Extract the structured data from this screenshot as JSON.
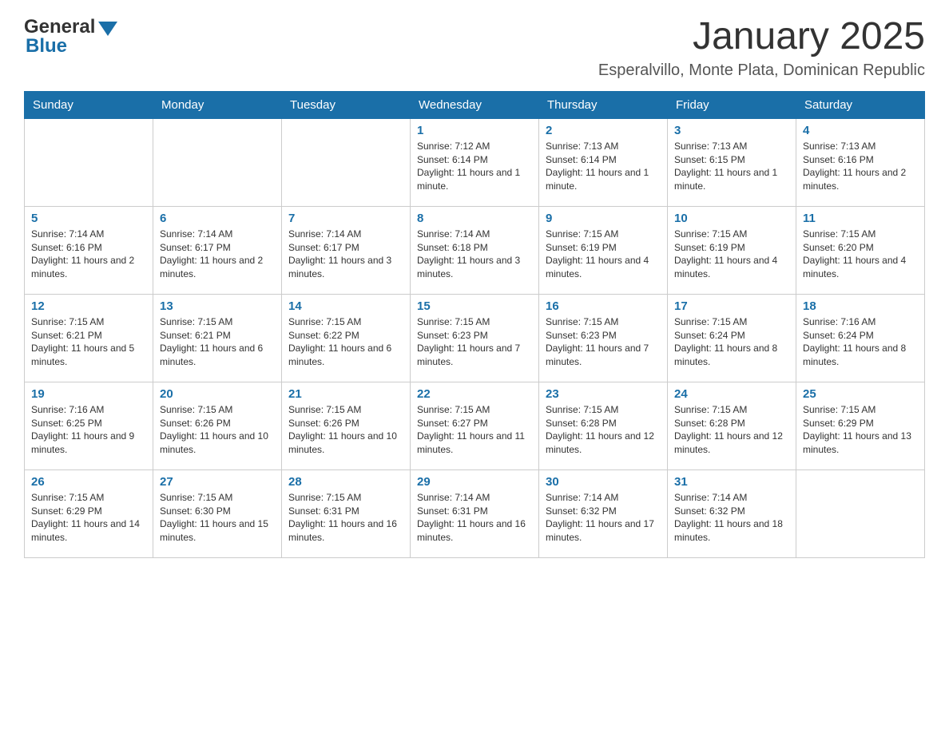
{
  "header": {
    "logo_general": "General",
    "logo_blue": "Blue",
    "title": "January 2025",
    "subtitle": "Esperalvillo, Monte Plata, Dominican Republic"
  },
  "weekdays": [
    "Sunday",
    "Monday",
    "Tuesday",
    "Wednesday",
    "Thursday",
    "Friday",
    "Saturday"
  ],
  "weeks": [
    [
      {
        "day": "",
        "info": ""
      },
      {
        "day": "",
        "info": ""
      },
      {
        "day": "",
        "info": ""
      },
      {
        "day": "1",
        "info": "Sunrise: 7:12 AM\nSunset: 6:14 PM\nDaylight: 11 hours and 1 minute."
      },
      {
        "day": "2",
        "info": "Sunrise: 7:13 AM\nSunset: 6:14 PM\nDaylight: 11 hours and 1 minute."
      },
      {
        "day": "3",
        "info": "Sunrise: 7:13 AM\nSunset: 6:15 PM\nDaylight: 11 hours and 1 minute."
      },
      {
        "day": "4",
        "info": "Sunrise: 7:13 AM\nSunset: 6:16 PM\nDaylight: 11 hours and 2 minutes."
      }
    ],
    [
      {
        "day": "5",
        "info": "Sunrise: 7:14 AM\nSunset: 6:16 PM\nDaylight: 11 hours and 2 minutes."
      },
      {
        "day": "6",
        "info": "Sunrise: 7:14 AM\nSunset: 6:17 PM\nDaylight: 11 hours and 2 minutes."
      },
      {
        "day": "7",
        "info": "Sunrise: 7:14 AM\nSunset: 6:17 PM\nDaylight: 11 hours and 3 minutes."
      },
      {
        "day": "8",
        "info": "Sunrise: 7:14 AM\nSunset: 6:18 PM\nDaylight: 11 hours and 3 minutes."
      },
      {
        "day": "9",
        "info": "Sunrise: 7:15 AM\nSunset: 6:19 PM\nDaylight: 11 hours and 4 minutes."
      },
      {
        "day": "10",
        "info": "Sunrise: 7:15 AM\nSunset: 6:19 PM\nDaylight: 11 hours and 4 minutes."
      },
      {
        "day": "11",
        "info": "Sunrise: 7:15 AM\nSunset: 6:20 PM\nDaylight: 11 hours and 4 minutes."
      }
    ],
    [
      {
        "day": "12",
        "info": "Sunrise: 7:15 AM\nSunset: 6:21 PM\nDaylight: 11 hours and 5 minutes."
      },
      {
        "day": "13",
        "info": "Sunrise: 7:15 AM\nSunset: 6:21 PM\nDaylight: 11 hours and 6 minutes."
      },
      {
        "day": "14",
        "info": "Sunrise: 7:15 AM\nSunset: 6:22 PM\nDaylight: 11 hours and 6 minutes."
      },
      {
        "day": "15",
        "info": "Sunrise: 7:15 AM\nSunset: 6:23 PM\nDaylight: 11 hours and 7 minutes."
      },
      {
        "day": "16",
        "info": "Sunrise: 7:15 AM\nSunset: 6:23 PM\nDaylight: 11 hours and 7 minutes."
      },
      {
        "day": "17",
        "info": "Sunrise: 7:15 AM\nSunset: 6:24 PM\nDaylight: 11 hours and 8 minutes."
      },
      {
        "day": "18",
        "info": "Sunrise: 7:16 AM\nSunset: 6:24 PM\nDaylight: 11 hours and 8 minutes."
      }
    ],
    [
      {
        "day": "19",
        "info": "Sunrise: 7:16 AM\nSunset: 6:25 PM\nDaylight: 11 hours and 9 minutes."
      },
      {
        "day": "20",
        "info": "Sunrise: 7:15 AM\nSunset: 6:26 PM\nDaylight: 11 hours and 10 minutes."
      },
      {
        "day": "21",
        "info": "Sunrise: 7:15 AM\nSunset: 6:26 PM\nDaylight: 11 hours and 10 minutes."
      },
      {
        "day": "22",
        "info": "Sunrise: 7:15 AM\nSunset: 6:27 PM\nDaylight: 11 hours and 11 minutes."
      },
      {
        "day": "23",
        "info": "Sunrise: 7:15 AM\nSunset: 6:28 PM\nDaylight: 11 hours and 12 minutes."
      },
      {
        "day": "24",
        "info": "Sunrise: 7:15 AM\nSunset: 6:28 PM\nDaylight: 11 hours and 12 minutes."
      },
      {
        "day": "25",
        "info": "Sunrise: 7:15 AM\nSunset: 6:29 PM\nDaylight: 11 hours and 13 minutes."
      }
    ],
    [
      {
        "day": "26",
        "info": "Sunrise: 7:15 AM\nSunset: 6:29 PM\nDaylight: 11 hours and 14 minutes."
      },
      {
        "day": "27",
        "info": "Sunrise: 7:15 AM\nSunset: 6:30 PM\nDaylight: 11 hours and 15 minutes."
      },
      {
        "day": "28",
        "info": "Sunrise: 7:15 AM\nSunset: 6:31 PM\nDaylight: 11 hours and 16 minutes."
      },
      {
        "day": "29",
        "info": "Sunrise: 7:14 AM\nSunset: 6:31 PM\nDaylight: 11 hours and 16 minutes."
      },
      {
        "day": "30",
        "info": "Sunrise: 7:14 AM\nSunset: 6:32 PM\nDaylight: 11 hours and 17 minutes."
      },
      {
        "day": "31",
        "info": "Sunrise: 7:14 AM\nSunset: 6:32 PM\nDaylight: 11 hours and 18 minutes."
      },
      {
        "day": "",
        "info": ""
      }
    ]
  ]
}
